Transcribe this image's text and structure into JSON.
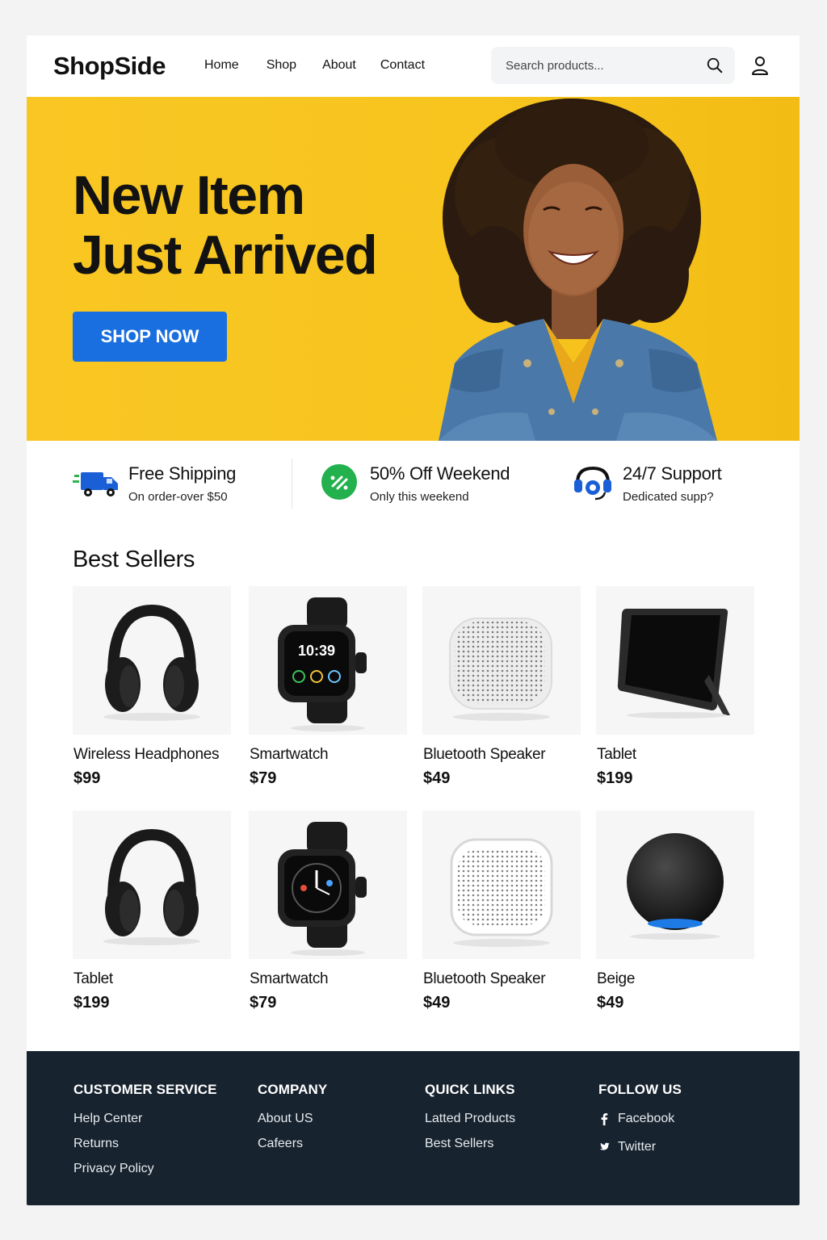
{
  "brand": "ShopSide",
  "nav": [
    "Home",
    "Shop",
    "About",
    "Contact"
  ],
  "search": {
    "placeholder": "Search products..."
  },
  "icons": {
    "search": "search-icon",
    "user": "user-icon",
    "truck": "truck-icon",
    "discount": "discount-icon",
    "support": "headset-icon"
  },
  "colors": {
    "hero_bg": "#f9c623",
    "button": "#1a6fe0",
    "footer_bg": "#17232f",
    "discount_green": "#22b14c"
  },
  "hero": {
    "title_line1": "New Item",
    "title_line2": "Just Arrived",
    "cta": "SHOP NOW"
  },
  "features": [
    {
      "title": "Free Shipping",
      "subtitle": "On order-over $50"
    },
    {
      "title": "50% Off Weekend",
      "subtitle": "Only this weekend"
    },
    {
      "title": "24/7 Support",
      "subtitle": "Dedicated supp?"
    }
  ],
  "best_sellers": {
    "title": "Best Sellers",
    "products": [
      {
        "name": "Wireless Headphones",
        "price": "$99",
        "image": "headphones"
      },
      {
        "name": "Smartwatch",
        "price": "$79",
        "image": "smartwatch",
        "watch_time": "10:39"
      },
      {
        "name": "Bluetooth Speaker",
        "price": "$49",
        "image": "speaker"
      },
      {
        "name": "Tablet",
        "price": "$199",
        "image": "tablet"
      },
      {
        "name": "Tablet",
        "price": "$199",
        "image": "headphones"
      },
      {
        "name": "Smartwatch",
        "price": "$79",
        "image": "smartwatch"
      },
      {
        "name": "Bluetooth Speaker",
        "price": "$49",
        "image": "speaker"
      },
      {
        "name": "Beige",
        "price": "$49",
        "image": "smart-speaker"
      }
    ]
  },
  "footer": {
    "columns": [
      {
        "heading": "CUSTOMER SERVICE",
        "links": [
          "Help Center",
          "Returns",
          "Privacy Policy"
        ]
      },
      {
        "heading": "COMPANY",
        "links": [
          "About US",
          "Cafeers"
        ]
      },
      {
        "heading": "QUICK LINKS",
        "links": [
          "Latted Products",
          "Best Sellers"
        ]
      },
      {
        "heading": "FOLLOW US",
        "links": [
          "Facebook",
          "Twitter"
        ]
      }
    ]
  }
}
